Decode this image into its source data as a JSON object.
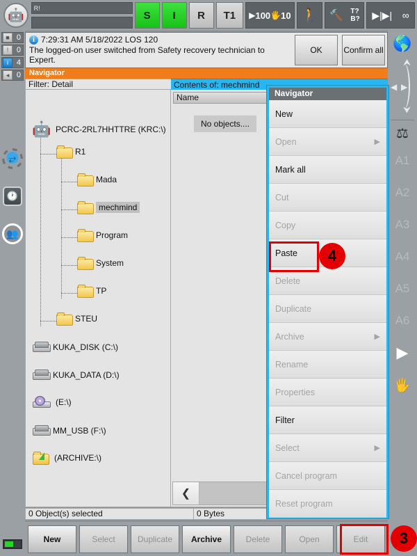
{
  "topbar": {
    "logo_icon": "kuka-robot-logo",
    "message_field_1": "R!",
    "message_field_2": "",
    "status_s": "S",
    "status_i": "I",
    "status_r": "R",
    "mode": "T1",
    "override_program": "100",
    "override_jog": "10",
    "manual_icon": "walking-man-icon",
    "tool_label": "T?",
    "base_label": "B?",
    "increment_icon": "increment-icon",
    "infinity_label": "∞"
  },
  "left_rail": {
    "counters": [
      {
        "icon": "stop-icon",
        "value": "0"
      },
      {
        "icon": "warning-icon",
        "value": "0"
      },
      {
        "icon": "info-icon",
        "value": "4"
      },
      {
        "icon": "note-icon",
        "value": "0"
      }
    ],
    "icons": [
      {
        "name": "robot-settings-icon"
      },
      {
        "name": "clock-icon"
      },
      {
        "name": "users-icon"
      }
    ],
    "battery_icon": "battery-indicator"
  },
  "right_rail": {
    "globe_icon": "world-coordinates-icon",
    "jog_icon": "jog-arrows-icon",
    "robot_icon": "robot-axis-icon",
    "axes": [
      "A1",
      "A2",
      "A3",
      "A4",
      "A5",
      "A6"
    ],
    "play_icon": "play-icon",
    "hand_icon": "hand-jog-icon"
  },
  "message": {
    "info_icon": "info-icon",
    "timestamp": "7:29:31 AM 5/18/2022 LOS 120",
    "text": "The logged-on user switched from Safety recovery technician to Expert.",
    "ok_label": "OK",
    "confirm_all_label": "Confirm all"
  },
  "navigator": {
    "title": "Navigator",
    "filter_label": "Filter: Detail",
    "contents_label": "Contents of: mechmind",
    "name_column": "Name",
    "sort_icon": "sort-ascending-icon",
    "empty_text": "No objects....",
    "scroll_left_icon": "chevron-left-icon",
    "tree": [
      {
        "label": "PCRC-2RL7HHTTRE (KRC:\\)",
        "icon": "robot-icon",
        "indent": 0,
        "selected": false
      },
      {
        "label": "R1",
        "icon": "folder-icon",
        "indent": 1,
        "selected": false
      },
      {
        "label": "Mada",
        "icon": "folder-icon",
        "indent": 2,
        "selected": false
      },
      {
        "label": "mechmind",
        "icon": "folder-icon",
        "indent": 2,
        "selected": true
      },
      {
        "label": "Program",
        "icon": "folder-icon",
        "indent": 2,
        "selected": false
      },
      {
        "label": "System",
        "icon": "folder-icon",
        "indent": 2,
        "selected": false
      },
      {
        "label": "TP",
        "icon": "folder-icon",
        "indent": 2,
        "selected": false
      },
      {
        "label": "STEU",
        "icon": "folder-icon",
        "indent": 1,
        "selected": false
      },
      {
        "label": "KUKA_DISK (C:\\)",
        "icon": "drive-icon",
        "indent": 0,
        "selected": false
      },
      {
        "label": "KUKA_DATA (D:\\)",
        "icon": "drive-icon",
        "indent": 0,
        "selected": false
      },
      {
        "label": "(E:\\)",
        "icon": "cd-drive-icon",
        "indent": 0,
        "selected": false
      },
      {
        "label": "MM_USB (F:\\)",
        "icon": "usb-drive-icon",
        "indent": 0,
        "selected": false
      },
      {
        "label": "(ARCHIVE:\\)",
        "icon": "archive-folder-icon",
        "indent": 0,
        "selected": false
      }
    ]
  },
  "status_line": {
    "objects_selected": "0 Object(s) selected",
    "size": "0 Bytes"
  },
  "context_menu": {
    "title": "Navigator",
    "items": [
      {
        "label": "New",
        "enabled": true,
        "submenu": false
      },
      {
        "label": "Open",
        "enabled": false,
        "submenu": true
      },
      {
        "label": "Mark all",
        "enabled": true,
        "submenu": false
      },
      {
        "label": "Cut",
        "enabled": false,
        "submenu": false
      },
      {
        "label": "Copy",
        "enabled": false,
        "submenu": false
      },
      {
        "label": "Paste",
        "enabled": true,
        "submenu": false
      },
      {
        "label": "Delete",
        "enabled": false,
        "submenu": false
      },
      {
        "label": "Duplicate",
        "enabled": false,
        "submenu": false
      },
      {
        "label": "Archive",
        "enabled": false,
        "submenu": true
      },
      {
        "label": "Rename",
        "enabled": false,
        "submenu": false
      },
      {
        "label": "Properties",
        "enabled": false,
        "submenu": false
      },
      {
        "label": "Filter",
        "enabled": true,
        "submenu": false
      },
      {
        "label": "Select",
        "enabled": false,
        "submenu": true
      },
      {
        "label": "Cancel program",
        "enabled": false,
        "submenu": false
      },
      {
        "label": "Reset program",
        "enabled": false,
        "submenu": false
      }
    ]
  },
  "bottom_buttons": [
    {
      "label": "New",
      "enabled": true
    },
    {
      "label": "Select",
      "enabled": false
    },
    {
      "label": "Duplicate",
      "enabled": false
    },
    {
      "label": "Archive",
      "enabled": true
    },
    {
      "label": "Delete",
      "enabled": false
    },
    {
      "label": "Open",
      "enabled": false
    },
    {
      "label": "Edit",
      "enabled": false
    }
  ],
  "annotations": [
    {
      "badge": "4",
      "target": "paste-menu-item"
    },
    {
      "badge": "3",
      "target": "edit-button"
    }
  ],
  "colors": {
    "accent_orange": "#f07d1a",
    "accent_cyan": "#29b6f0",
    "annotation_red": "#e40000",
    "status_green": "#25d625"
  }
}
